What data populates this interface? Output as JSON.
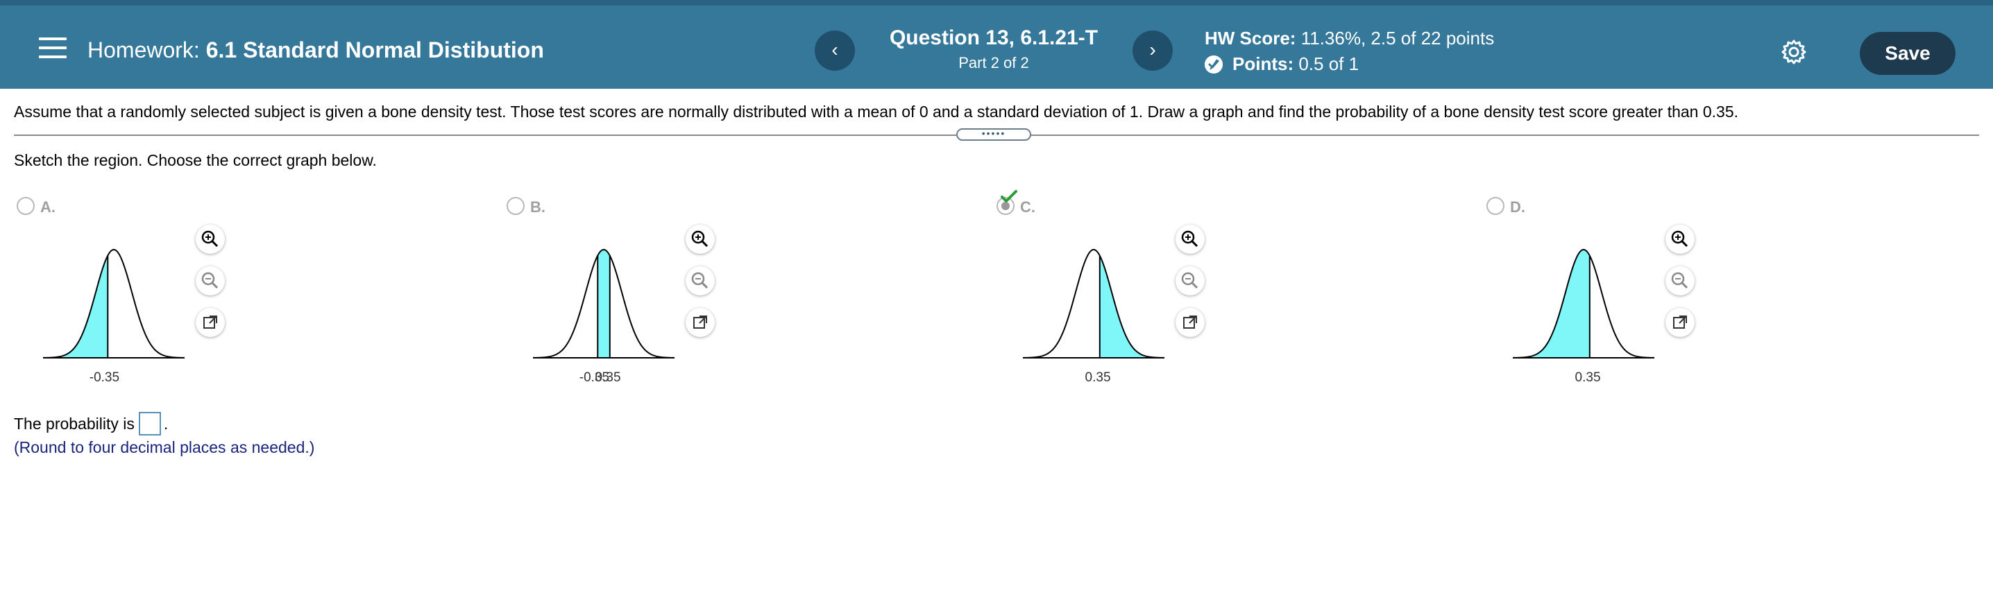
{
  "header": {
    "homework_prefix": "Homework:",
    "homework_name": "6.1 Standard Normal Distibution",
    "question_title": "Question 13, 6.1.21-T",
    "question_part": "Part 2 of 2",
    "prev_label": "‹",
    "next_label": "›",
    "hw_score_label": "HW Score:",
    "hw_score_value": "11.36%, 2.5 of 22 points",
    "points_label": "Points:",
    "points_value": "0.5 of 1",
    "save_label": "Save",
    "colors": {
      "bar": "#36789a",
      "save": "#1e3a4f"
    }
  },
  "question": {
    "text": "Assume that a randomly selected subject is given a bone density test. Those test scores are normally distributed with a mean of 0 and a standard deviation of 1. Draw a graph and find the probability of a bone density test score greater than 0.35.",
    "instruction": "Sketch the region. Choose the correct graph below.",
    "drag_handle": "•••••"
  },
  "options": [
    {
      "letter": "A.",
      "ticks": [
        "-0.35"
      ],
      "selected": false
    },
    {
      "letter": "B.",
      "ticks": [
        "-0.35",
        "0.35"
      ],
      "selected": false
    },
    {
      "letter": "C.",
      "ticks": [
        "0.35"
      ],
      "selected": true
    },
    {
      "letter": "D.",
      "ticks": [
        "0.35"
      ],
      "selected": false
    }
  ],
  "answer": {
    "prefix": "The probability is",
    "suffix": ".",
    "note": "(Round to four decimal places as needed.)"
  },
  "icons": {
    "menu": "menu-icon",
    "settings": "gear-icon",
    "points": "partial-points-icon",
    "zoom_in": "zoom-in-icon",
    "zoom_out": "zoom-out-icon",
    "open": "open-external-icon",
    "check": "check-icon"
  },
  "shade_color": "#7ff7f9"
}
